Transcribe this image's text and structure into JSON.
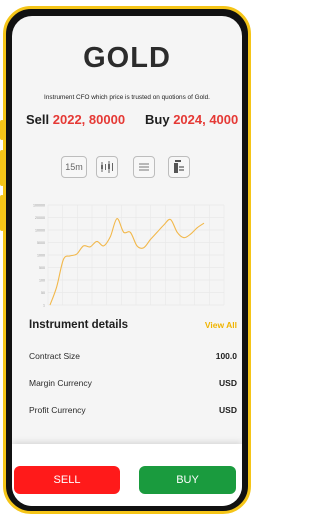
{
  "header": {
    "title": "GOLD",
    "subtitle": "Instrument CFO which price is trusted on quotions of Gold."
  },
  "prices": {
    "sell_label": "Sell",
    "sell_value": "2022, 80000",
    "buy_label": "Buy",
    "buy_value": "2024, 4000"
  },
  "toolbar": {
    "timeframe_label": "15m",
    "icons": [
      "candlestick-icon",
      "list-icon",
      "indicator-icon"
    ]
  },
  "chart_data": {
    "type": "line",
    "y_tick_labels": [
      "100000",
      "20000",
      "10000",
      "5000",
      "1000",
      "500",
      "100",
      "50",
      "1"
    ],
    "series": [
      {
        "color": "#f2b84b",
        "values": [
          0,
          2,
          5,
          5.4,
          5.6,
          6.5,
          6.4,
          7.0,
          6.5,
          7.5,
          9.5,
          8.0,
          8.0,
          6.5,
          6.3,
          7.2,
          8.0,
          8.8,
          9.4,
          8.0,
          7.4,
          7.8,
          8.5,
          9.0
        ]
      }
    ],
    "ylim": [
      0,
      11
    ],
    "grid": true
  },
  "details": {
    "title": "Instrument details",
    "view_all": "View All",
    "rows": [
      {
        "label": "Contract Size",
        "value": "100.0"
      },
      {
        "label": "Margin Currency",
        "value": "USD"
      },
      {
        "label": "Profit Currency",
        "value": "USD"
      }
    ]
  },
  "actions": {
    "sell": "SELL",
    "buy": "BUY"
  },
  "colors": {
    "frame": "#f5c518",
    "sell_price": "#e53935",
    "view_all": "#f0b400",
    "sell_button": "#ff1a1a",
    "buy_button": "#1a9b3e",
    "line": "#f2b84b"
  }
}
